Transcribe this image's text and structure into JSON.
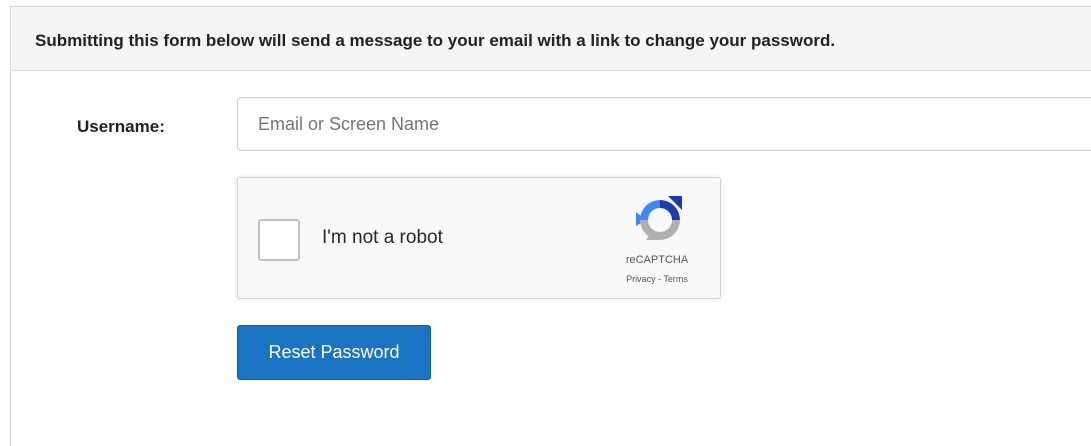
{
  "form": {
    "header_text": "Submitting this form below will send a message to your email with a link to change your password.",
    "username_label": "Username:",
    "username_placeholder": "Email or Screen Name",
    "username_value": "",
    "submit_label": "Reset Password"
  },
  "recaptcha": {
    "checkbox_label": "I'm not a robot",
    "checked": false,
    "brand": "reCAPTCHA",
    "privacy_link": "Privacy",
    "separator": " - ",
    "terms_link": "Terms",
    "logo_icon": "recaptcha-logo-icon"
  },
  "colors": {
    "primary_button": "#1a73c3",
    "header_background": "#f5f5f5",
    "recaptcha_blue": "#1c3aa9",
    "recaptcha_light_blue": "#4285f4",
    "recaptcha_gray": "#b0b0b0"
  }
}
